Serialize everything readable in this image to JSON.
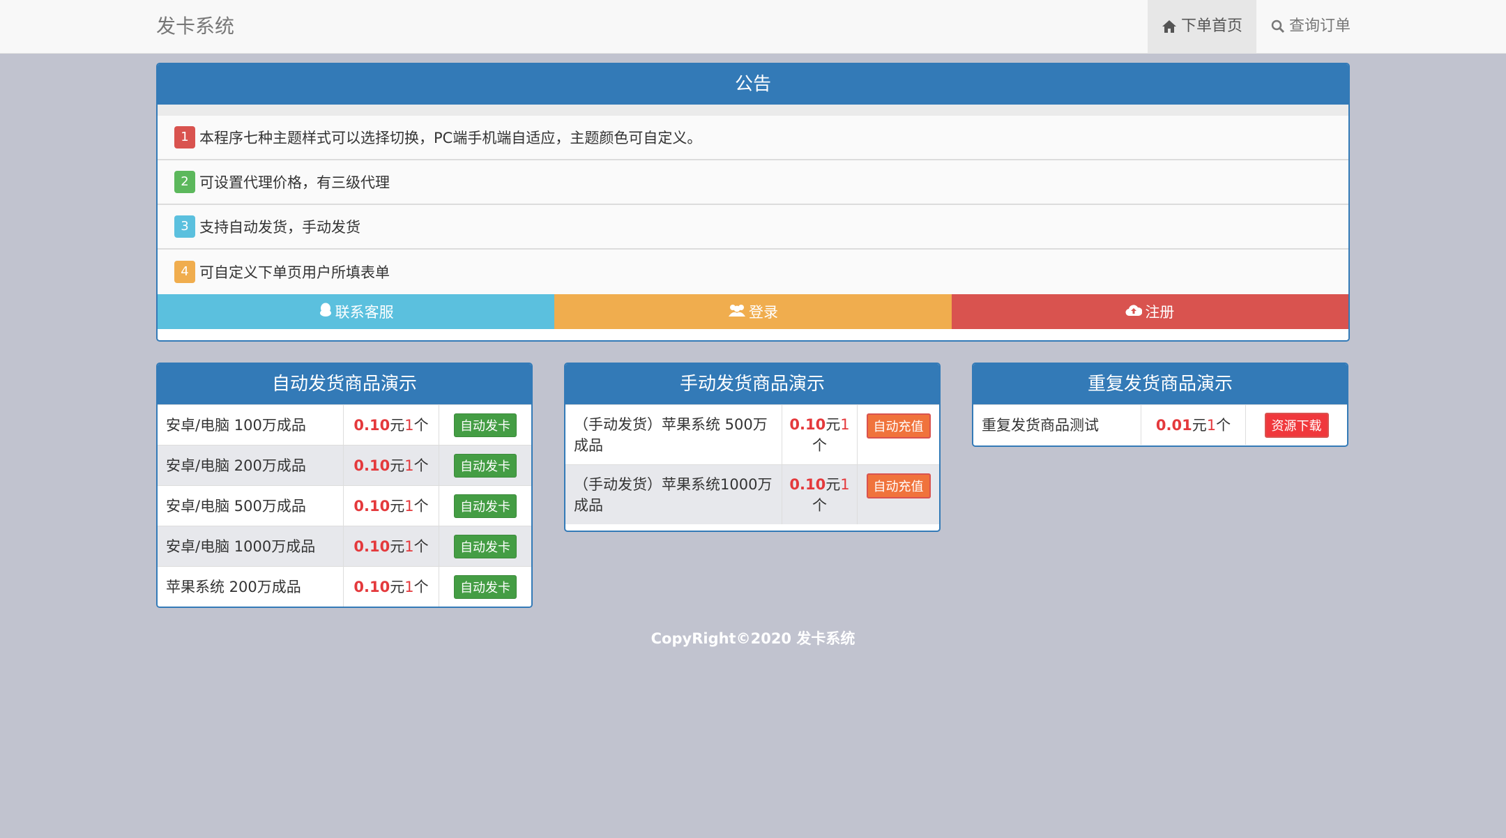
{
  "nav": {
    "brand": "发卡系统",
    "home": "下单首页",
    "query": "查询订单"
  },
  "notice": {
    "title": "公告",
    "items": [
      {
        "num": "1",
        "text": "本程序七种主题样式可以选择切换，PC端手机端自适应，主题颜色可自定义。"
      },
      {
        "num": "2",
        "text": "可设置代理价格，有三级代理"
      },
      {
        "num": "3",
        "text": "支持自动发货，手动发货"
      },
      {
        "num": "4",
        "text": "可自定义下单页用户所填表单"
      }
    ],
    "actions": {
      "contact": "联系客服",
      "login": "登录",
      "register": "注册"
    }
  },
  "panels": [
    {
      "title": "自动发货商品演示",
      "rows": [
        {
          "name": "安卓/电脑 100万成品",
          "price": "0.10",
          "unit": "元",
          "qty": "1",
          "qty_unit": "个",
          "button": "自动发卡"
        },
        {
          "name": "安卓/电脑 200万成品",
          "price": "0.10",
          "unit": "元",
          "qty": "1",
          "qty_unit": "个",
          "button": "自动发卡"
        },
        {
          "name": "安卓/电脑 500万成品",
          "price": "0.10",
          "unit": "元",
          "qty": "1",
          "qty_unit": "个",
          "button": "自动发卡"
        },
        {
          "name": "安卓/电脑 1000万成品",
          "price": "0.10",
          "unit": "元",
          "qty": "1",
          "qty_unit": "个",
          "button": "自动发卡"
        },
        {
          "name": "苹果系统 200万成品",
          "price": "0.10",
          "unit": "元",
          "qty": "1",
          "qty_unit": "个",
          "button": "自动发卡"
        }
      ]
    },
    {
      "title": "手动发货商品演示",
      "rows": [
        {
          "name": "（手动发货）苹果系统 500万成品",
          "price": "0.10",
          "unit": "元",
          "qty": "1",
          "qty_unit": "个",
          "button": "自动充值"
        },
        {
          "name": "（手动发货）苹果系统1000万成品",
          "price": "0.10",
          "unit": "元",
          "qty": "1",
          "qty_unit": "个",
          "button": "自动充值"
        }
      ]
    },
    {
      "title": "重复发货商品演示",
      "rows": [
        {
          "name": "重复发货商品测试",
          "price": "0.01",
          "unit": "元",
          "qty": "1",
          "qty_unit": "个",
          "button": "资源下载"
        }
      ]
    }
  ],
  "footer": "CopyRight©2020 发卡系统",
  "colors": {
    "primary": "#337ab7",
    "info": "#5bc0de",
    "warning": "#f0ad4e",
    "danger": "#d9534f",
    "success": "#449d44",
    "price": "#e4393c"
  },
  "icons": {
    "home": "home-icon",
    "query": "search-icon",
    "contact": "qq-icon",
    "login": "users-icon",
    "register": "cloud-upload-icon"
  }
}
